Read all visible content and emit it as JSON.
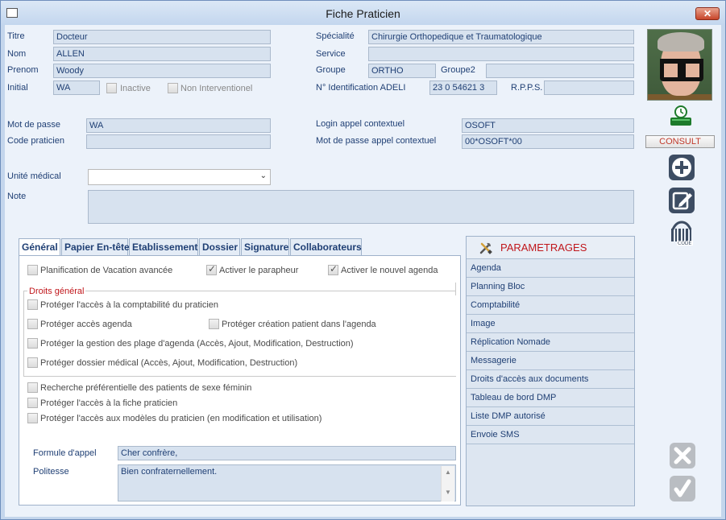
{
  "window": {
    "title": "Fiche Praticien",
    "close_label": "✕"
  },
  "identity": {
    "titre_label": "Titre",
    "titre_value": "Docteur",
    "nom_label": "Nom",
    "nom_value": "ALLEN",
    "prenom_label": "Prenom",
    "prenom_value": "Woody",
    "initial_label": "Initial",
    "initial_value": "WA",
    "inactive_label": "Inactive",
    "non_interventionel_label": "Non Interventionel",
    "specialite_label": "Spécialité",
    "specialite_value": "Chirurgie Orthopedique et Traumatologique",
    "service_label": "Service",
    "service_value": "",
    "groupe_label": "Groupe",
    "groupe_value": "ORTHO",
    "groupe2_label": "Groupe2",
    "groupe2_value": "",
    "adeli_label": "N° Identification ADELI",
    "adeli_value": "23 0 54621 3",
    "rpps_label": "R.P.P.S.",
    "rpps_value": ""
  },
  "credentials": {
    "mdp_label": "Mot de passe",
    "mdp_value": "WA",
    "code_label": "Code praticien",
    "code_value": "",
    "login_ctx_label": "Login appel contextuel",
    "login_ctx_value": "OSOFT",
    "mdp_ctx_label": "Mot de passe appel contextuel",
    "mdp_ctx_value": "00*OSOFT*00"
  },
  "unite": {
    "label": "Unité médical",
    "value": ""
  },
  "note": {
    "label": "Note",
    "value": ""
  },
  "side": {
    "consult_label": "CONSULT"
  },
  "tabs": [
    "Général",
    "Papier En-tête",
    "Etablissement",
    "Dossier",
    "Signature",
    "Collaborateurs"
  ],
  "general": {
    "planif_label": "Planification de Vacation avancée",
    "parapheur_label": "Activer le parapheur",
    "nouvel_agenda_label": "Activer le nouvel agenda",
    "droits_title": "Droits général",
    "droits": {
      "compta": "Protéger l'accès à la comptabilité du praticien",
      "agenda": "Protéger accès agenda",
      "creation_patient": "Protéger création patient dans l'agenda",
      "plage": "Protéger la gestion des plage d'agenda (Accès, Ajout, Modification, Destruction)",
      "dossier": "Protéger dossier médical (Accès, Ajout, Modification, Destruction)"
    },
    "recherche_label": "Recherche préférentielle des patients de sexe féminin",
    "fiche_label": "Protéger l'accès à la fiche praticien",
    "modeles_label": "Protéger l'accès aux modèles du praticien (en modification et utilisation)",
    "formule_label": "Formule d'appel",
    "formule_value": "Cher confrère,",
    "politesse_label": "Politesse",
    "politesse_value": "Bien confraternellement."
  },
  "parametrages": {
    "title": "PARAMETRAGES",
    "items": [
      "Agenda",
      "Planning Bloc",
      "Comptabilité",
      "Image",
      "Réplication Nomade",
      "Messagerie",
      "Droits d'accès aux documents",
      "Tableau de bord DMP",
      "Liste DMP autorisé",
      "Envoie SMS"
    ]
  },
  "colors": {
    "accent": "#c0161b",
    "label": "#1f3f74",
    "field_bg": "#d7e2ef"
  }
}
